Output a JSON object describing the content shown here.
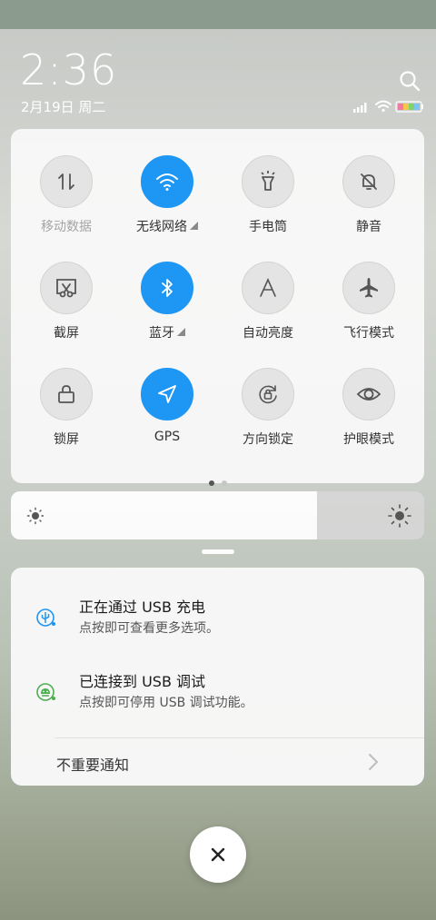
{
  "status": {
    "time": "2:36",
    "date": "2月19日 周二"
  },
  "quick_settings": {
    "tiles": [
      {
        "label": "移动数据",
        "icon": "mobile-data-icon",
        "active": false
      },
      {
        "label": "无线网络",
        "icon": "wifi-icon",
        "active": true
      },
      {
        "label": "手电筒",
        "icon": "flashlight-icon",
        "active": false
      },
      {
        "label": "静音",
        "icon": "silent-bell-icon",
        "active": false
      },
      {
        "label": "截屏",
        "icon": "screenshot-icon",
        "active": false
      },
      {
        "label": "蓝牙",
        "icon": "bluetooth-icon",
        "active": true
      },
      {
        "label": "自动亮度",
        "icon": "auto-brightness-icon",
        "active": false
      },
      {
        "label": "飞行模式",
        "icon": "airplane-icon",
        "active": false
      },
      {
        "label": "锁屏",
        "icon": "lock-icon",
        "active": false
      },
      {
        "label": "GPS",
        "icon": "gps-icon",
        "active": true
      },
      {
        "label": "方向锁定",
        "icon": "rotation-lock-icon",
        "active": false
      },
      {
        "label": "护眼模式",
        "icon": "eye-icon",
        "active": false
      }
    ],
    "page_index": 1,
    "page_count": 2
  },
  "brightness": {
    "level": 0.74
  },
  "notifications": {
    "items": [
      {
        "title": "正在通过 USB 充电",
        "subtitle": "点按即可查看更多选项。",
        "icon": "usb-icon"
      },
      {
        "title": "已连接到 USB 调试",
        "subtitle": "点按即可停用 USB 调试功能。",
        "icon": "android-debug-icon"
      }
    ],
    "minor_label": "不重要通知"
  },
  "colors": {
    "accent": "#1e96f3",
    "panel": "#f8f8f8"
  }
}
